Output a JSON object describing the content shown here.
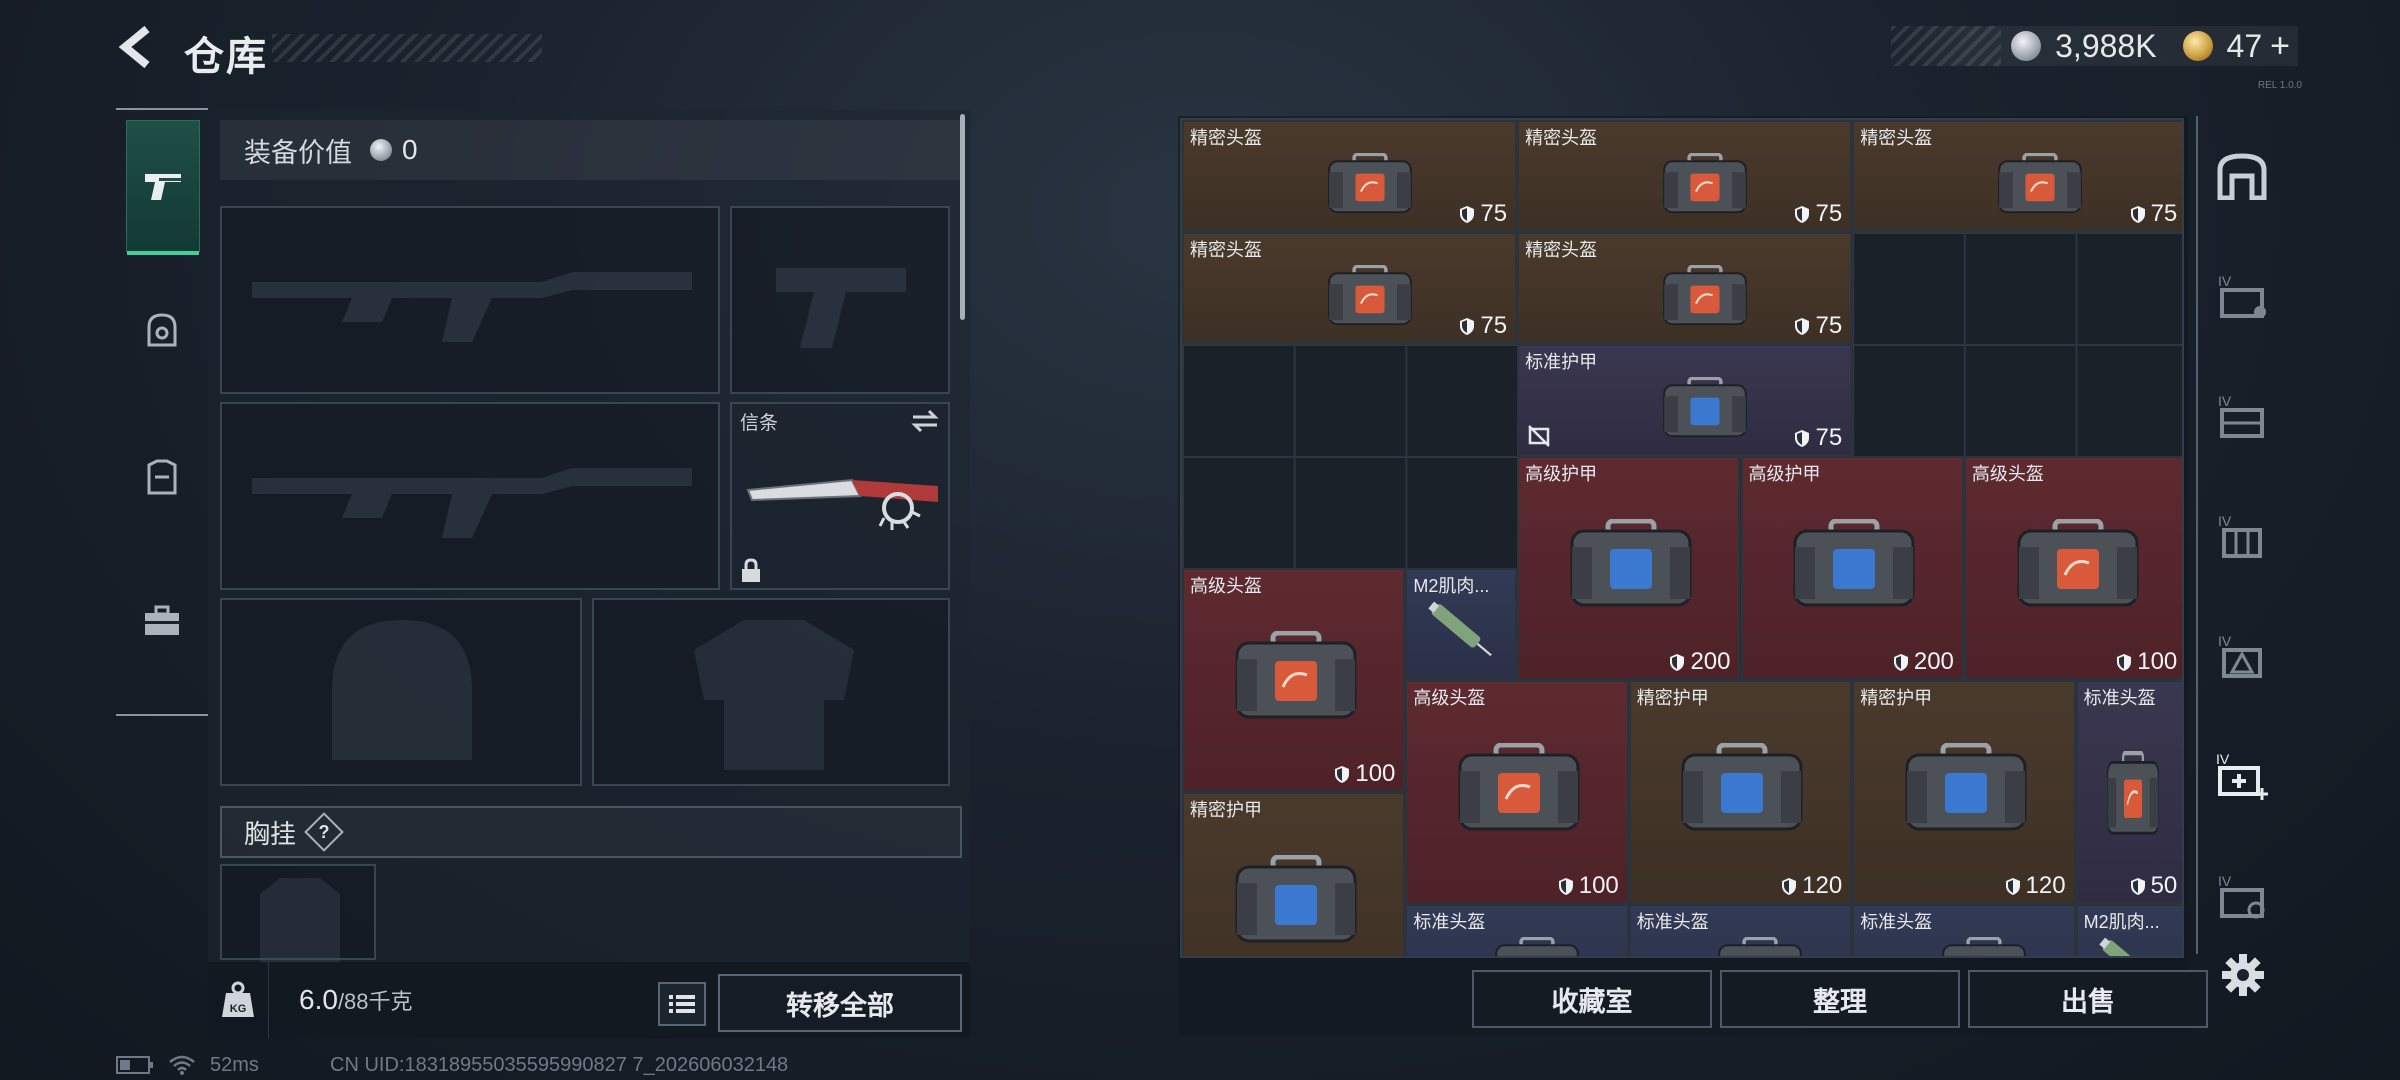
{
  "header": {
    "title": "仓库",
    "build_tag": "REL 1.0.0"
  },
  "currency": {
    "coins": "3,988K",
    "gold": "47",
    "plus": "+"
  },
  "loadout": {
    "value_label": "装备价值",
    "value": "0",
    "knife_slot_label": "信条",
    "chest_label": "胸挂",
    "help_mark": "?",
    "weight_value": "6.0",
    "weight_capacity": "/88千克",
    "transfer_all": "转移全部"
  },
  "storage": {
    "items": [
      {
        "name": "精密头盔",
        "dur": "75"
      },
      {
        "name": "精密头盔",
        "dur": "75"
      },
      {
        "name": "精密头盔",
        "dur": "75"
      },
      {
        "name": "精密头盔",
        "dur": "75"
      },
      {
        "name": "精密头盔",
        "dur": "75"
      },
      {
        "name": "标准护甲",
        "dur": "75"
      },
      {
        "name": "高级护甲",
        "dur": "200"
      },
      {
        "name": "高级护甲",
        "dur": "200"
      },
      {
        "name": "高级头盔",
        "dur": "100"
      },
      {
        "name": "高级头盔",
        "dur": "100"
      },
      {
        "name": "M2肌肉..."
      },
      {
        "name": "高级头盔",
        "dur": "100"
      },
      {
        "name": "精密护甲",
        "dur": "120"
      },
      {
        "name": "精密护甲",
        "dur": "120"
      },
      {
        "name": "标准头盔",
        "dur": "50"
      },
      {
        "name": "精密护甲"
      },
      {
        "name": "标准头盔"
      },
      {
        "name": "标准头盔"
      },
      {
        "name": "标准头盔"
      },
      {
        "name": "M2肌肉..."
      }
    ]
  },
  "actions": {
    "collection": "收藏室",
    "organize": "整理",
    "sell": "出售"
  },
  "status": {
    "ping": "52ms",
    "uid": "CN UID:18318955035595990827 7_202606032148"
  },
  "colors": {
    "accent": "#3fd09a",
    "rarity_red": "#5e2a30",
    "rarity_brown": "#4a3a2c",
    "rarity_purple": "#3a3750"
  }
}
